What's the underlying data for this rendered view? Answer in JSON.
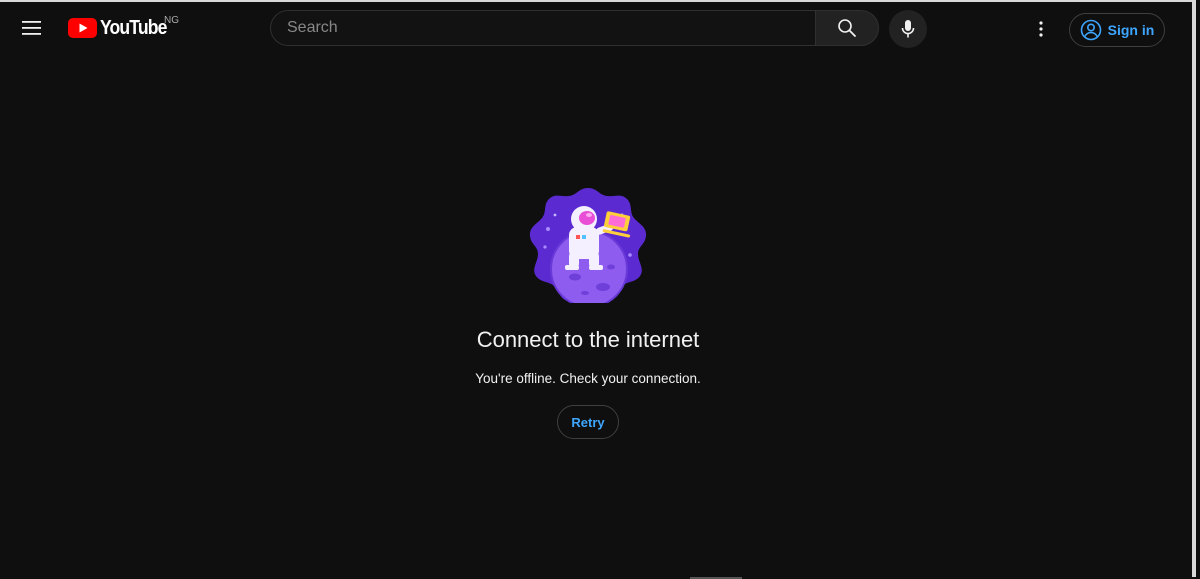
{
  "header": {
    "logo_text": "YouTube",
    "region_code": "NG",
    "search_placeholder": "Search",
    "search_value": "",
    "signin_label": "Sign in",
    "icons": {
      "menu": "hamburger-menu-icon",
      "search": "search-icon",
      "mic": "microphone-icon",
      "more": "more-vertical-icon",
      "account": "account-circle-icon"
    }
  },
  "offline": {
    "title": "Connect to the internet",
    "subtitle": "You're offline. Check your connection.",
    "retry_label": "Retry"
  },
  "colors": {
    "background": "#0f0f0f",
    "brand_red": "#ff0000",
    "link_blue": "#3ea6ff",
    "illustration_purple": "#7b3fe4"
  }
}
